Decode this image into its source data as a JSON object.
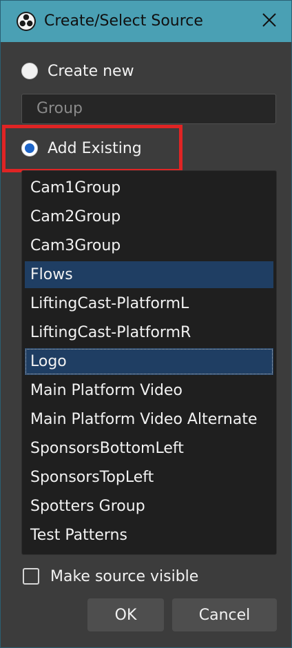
{
  "window": {
    "title": "Create/Select Source",
    "titlebar_color": "#4aa0b4",
    "icon": "obs-logo-icon",
    "close_icon": "close-icon"
  },
  "create_new": {
    "label": "Create new",
    "selected": false,
    "name_field_value": "Group"
  },
  "add_existing": {
    "label": "Add Existing",
    "selected": true,
    "highlight_color": "#e02424"
  },
  "sources": [
    {
      "label": "Cam1Group",
      "state": "normal"
    },
    {
      "label": "Cam2Group",
      "state": "normal"
    },
    {
      "label": "Cam3Group",
      "state": "normal"
    },
    {
      "label": "Flows",
      "state": "selected"
    },
    {
      "label": "LiftingCast-PlatformL",
      "state": "normal"
    },
    {
      "label": "LiftingCast-PlatformR",
      "state": "normal"
    },
    {
      "label": "Logo",
      "state": "focused"
    },
    {
      "label": "Main Platform Video",
      "state": "normal"
    },
    {
      "label": "Main Platform Video Alternate",
      "state": "normal"
    },
    {
      "label": "SponsorsBottomLeft",
      "state": "normal"
    },
    {
      "label": "SponsorsTopLeft",
      "state": "normal"
    },
    {
      "label": "Spotters Group",
      "state": "normal"
    },
    {
      "label": "Test Patterns",
      "state": "normal"
    }
  ],
  "make_visible": {
    "label": "Make source visible",
    "checked": false
  },
  "buttons": {
    "ok": "OK",
    "cancel": "Cancel"
  },
  "colors": {
    "background": "#3c3c3c",
    "list_background": "#1f1f1f",
    "selection": "#1f3e63",
    "radio_accent": "#1e65c8"
  }
}
